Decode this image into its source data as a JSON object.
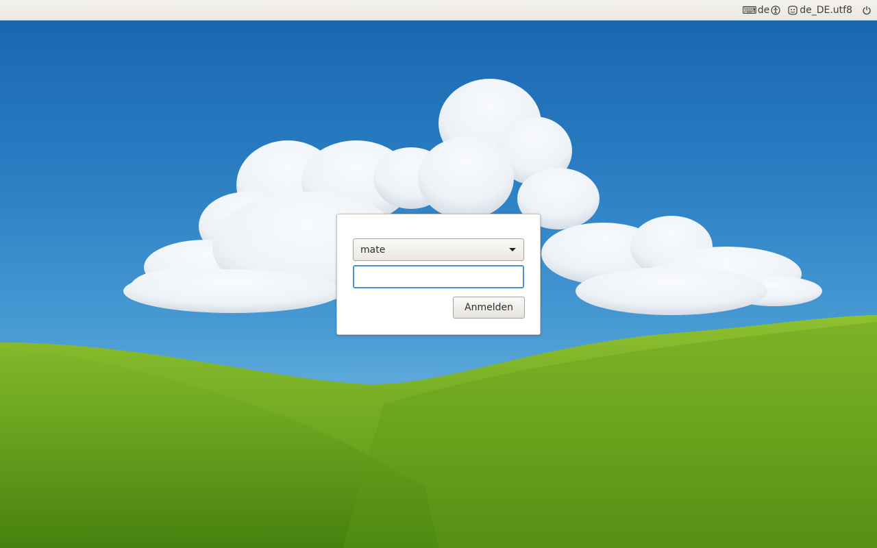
{
  "panel": {
    "keyboard_layout": "de",
    "session_label": "de_DE.utf8",
    "icons": {
      "keyboard": "keyboard-icon",
      "accessibility": "accessibility-icon",
      "session": "session-icon",
      "power": "power-icon"
    }
  },
  "login": {
    "selected_user": "mate",
    "password_value": "",
    "password_placeholder": "",
    "login_button_label": "Anmelden"
  },
  "colors": {
    "sky": "#2b7fc3",
    "grass": "#6aa520",
    "focus_border": "#4a90d9",
    "panel_bg": "#f0eee8"
  }
}
